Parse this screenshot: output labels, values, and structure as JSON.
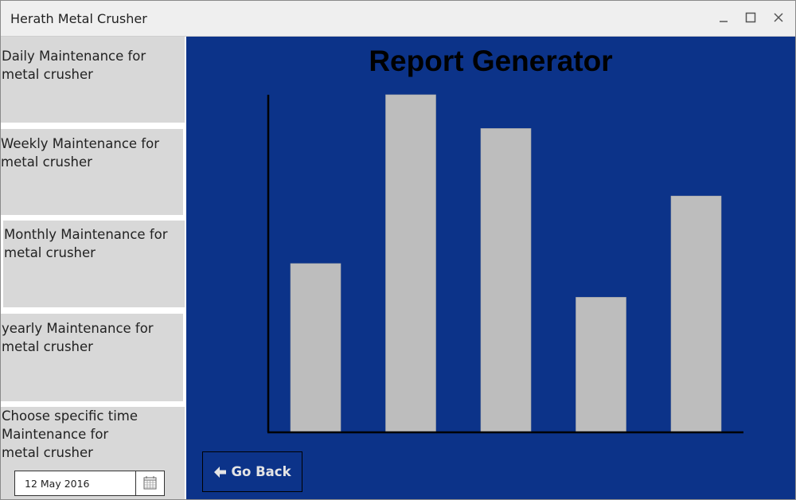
{
  "window": {
    "title": "Herath Metal Crusher",
    "controls": [
      "minimize-icon",
      "maximize-icon",
      "close-icon"
    ]
  },
  "sidebar": {
    "items": [
      {
        "line1": "Daily Maintenance for",
        "line2": "metal crusher"
      },
      {
        "line1": "Weekly Maintenance for",
        "line2": "metal crusher"
      },
      {
        "line1": "Monthly Maintenance for",
        "line2": "metal crusher"
      },
      {
        "line1": "yearly Maintenance for",
        "line2": "metal crusher"
      },
      {
        "line1": "Choose specific time",
        "line2": "Maintenance for",
        "line3": "metal crusher"
      }
    ],
    "date_value": "12 May 2016",
    "calendar_icon": "calendar-icon"
  },
  "main": {
    "title": "Report Generator",
    "go_back_label": "Go Back",
    "go_back_icon": "arrow-left-icon"
  },
  "colors": {
    "background": "#0c3389",
    "bar": "#bdbdbd",
    "sidebar_item": "#d8d8d8"
  },
  "chart_data": {
    "type": "bar",
    "categories": [
      "",
      "",
      "",
      "",
      ""
    ],
    "values": [
      50,
      100,
      90,
      40,
      70
    ],
    "title": "",
    "xlabel": "",
    "ylabel": "",
    "ylim": [
      0,
      100
    ],
    "grid": false,
    "legend": "none"
  }
}
